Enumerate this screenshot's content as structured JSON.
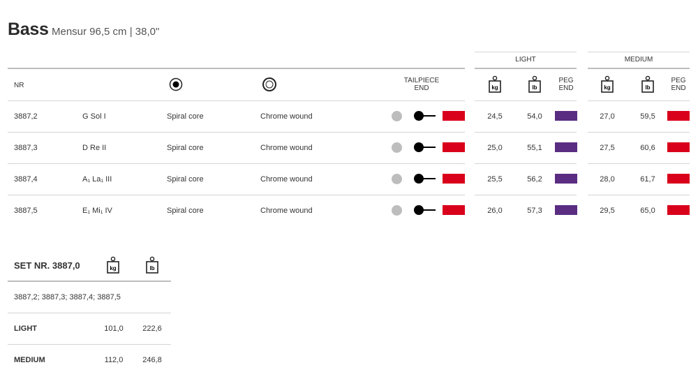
{
  "header": {
    "title": "Bass",
    "subtitle": "Mensur 96,5 cm | 38,0\""
  },
  "table": {
    "group_light": "LIGHT",
    "group_medium": "MEDIUM",
    "col_nr": "NR",
    "col_tailpiece": [
      "TAILPIECE",
      "END"
    ],
    "col_peg": [
      "PEG",
      "END"
    ],
    "icon_core": "filled-circle-icon",
    "icon_wound": "ring-icon",
    "unit_kg": "kg",
    "unit_lb": "lb",
    "colors": {
      "tailpiece_red": "#d9001b",
      "light_purple": "#5a2d82",
      "medium_red": "#d9001b",
      "dot_grey": "#bdbdbd"
    },
    "rows": [
      {
        "nr": "3887,2",
        "note": "G  Sol  I",
        "core": "Spiral core",
        "winding": "Chrome wound",
        "light_kg": "24,5",
        "light_lb": "54,0",
        "medium_kg": "27,0",
        "medium_lb": "59,5"
      },
      {
        "nr": "3887,3",
        "note": "D  Re  II",
        "core": "Spiral core",
        "winding": "Chrome wound",
        "light_kg": "25,0",
        "light_lb": "55,1",
        "medium_kg": "27,5",
        "medium_lb": "60,6"
      },
      {
        "nr": "3887,4",
        "note": "A₁  La₁  III",
        "core": "Spiral core",
        "winding": "Chrome wound",
        "light_kg": "25,5",
        "light_lb": "56,2",
        "medium_kg": "28,0",
        "medium_lb": "61,7"
      },
      {
        "nr": "3887,5",
        "note": "E₁  Mi₁  IV",
        "core": "Spiral core",
        "winding": "Chrome wound",
        "light_kg": "26,0",
        "light_lb": "57,3",
        "medium_kg": "29,5",
        "medium_lb": "65,0"
      }
    ]
  },
  "set": {
    "title": "SET NR. 3887,0",
    "unit_kg": "kg",
    "unit_lb": "lb",
    "members": "3887,2; 3887,3; 3887,4; 3887,5",
    "rows": [
      {
        "label": "LIGHT",
        "kg": "101,0",
        "lb": "222,6"
      },
      {
        "label": "MEDIUM",
        "kg": "112,0",
        "lb": "246,8"
      }
    ]
  }
}
